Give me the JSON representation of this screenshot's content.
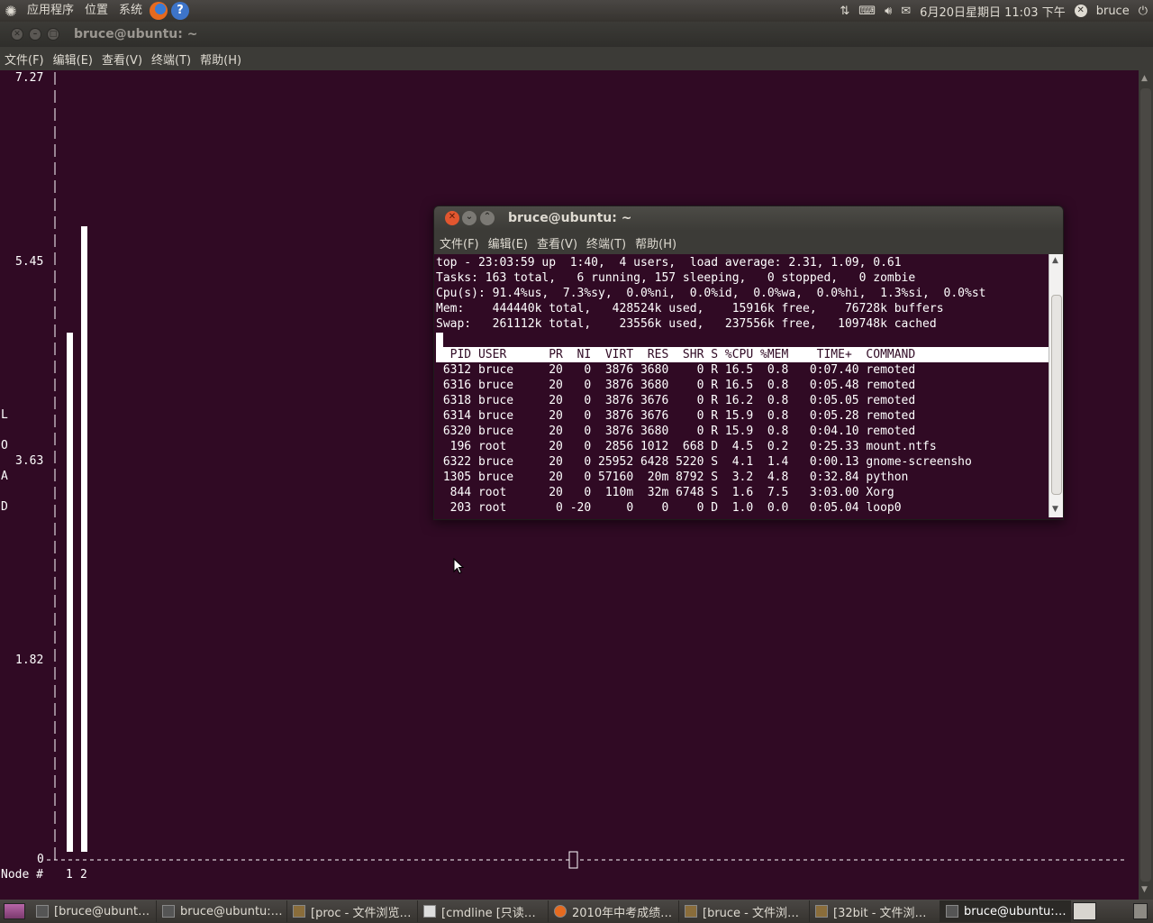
{
  "top_panel": {
    "menus": [
      "应用程序",
      "位置",
      "系统"
    ],
    "datetime": "6月20日星期日 11:03 下午",
    "user": "bruce"
  },
  "main_window": {
    "title": "bruce@ubuntu: ~",
    "menus": [
      "文件(F)",
      "编辑(E)",
      "查看(V)",
      "终端(T)",
      "帮助(H)"
    ],
    "load_chart": {
      "y_ticks": [
        "7.27",
        "5.45",
        "3.63",
        "1.82",
        "0"
      ],
      "side_label": [
        "L",
        "O",
        "A",
        "D"
      ],
      "x_axis_label": "Node #",
      "nodes": [
        "1",
        "2"
      ]
    }
  },
  "chart_data": {
    "type": "bar",
    "categories": [
      "1",
      "2"
    ],
    "values": [
      4.88,
      5.88
    ],
    "ylabel": "LOAD",
    "xlabel": "Node #",
    "ylim": [
      0,
      7.27
    ],
    "y_ticks": [
      7.27,
      5.45,
      3.63,
      1.82,
      0
    ]
  },
  "top_window": {
    "title": "bruce@ubuntu: ~",
    "menus": [
      "文件(F)",
      "编辑(E)",
      "查看(V)",
      "终端(T)",
      "帮助(H)"
    ],
    "summary": [
      "top - 23:03:59 up  1:40,  4 users,  load average: 2.31, 1.09, 0.61",
      "Tasks: 163 total,   6 running, 157 sleeping,   0 stopped,   0 zombie",
      "Cpu(s): 91.4%us,  7.3%sy,  0.0%ni,  0.0%id,  0.0%wa,  0.0%hi,  1.3%si,  0.0%st",
      "Mem:    444440k total,   428524k used,    15916k free,    76728k buffers",
      "Swap:   261112k total,    23556k used,   237556k free,   109748k cached"
    ],
    "header": "  PID USER      PR  NI  VIRT  RES  SHR S %CPU %MEM    TIME+  COMMAND",
    "rows": [
      " 6312 bruce     20   0  3876 3680    0 R 16.5  0.8   0:07.40 remoted",
      " 6316 bruce     20   0  3876 3680    0 R 16.5  0.8   0:05.48 remoted",
      " 6318 bruce     20   0  3876 3676    0 R 16.2  0.8   0:05.05 remoted",
      " 6314 bruce     20   0  3876 3676    0 R 15.9  0.8   0:05.28 remoted",
      " 6320 bruce     20   0  3876 3680    0 R 15.9  0.8   0:04.10 remoted",
      "  196 root      20   0  2856 1012  668 D  4.5  0.2   0:25.33 mount.ntfs",
      " 6322 bruce     20   0 25952 6428 5220 S  4.1  1.4   0:00.13 gnome-screensho",
      " 1305 bruce     20   0 57160  20m 8792 S  3.2  4.8   0:32.84 python",
      "  844 root      20   0  110m  32m 6748 S  1.6  7.5   3:03.00 Xorg",
      "  203 root       0 -20     0    0    0 D  1.0  0.0   0:05.04 loop0"
    ]
  },
  "taskbar": {
    "tasks": [
      {
        "label": "[bruce@ubunt…",
        "active": false
      },
      {
        "label": "bruce@ubuntu:…",
        "active": false
      },
      {
        "label": "[proc - 文件浏览…",
        "active": false
      },
      {
        "label": "[cmdline [只读…",
        "active": false
      },
      {
        "label": "2010年中考成绩…",
        "active": false
      },
      {
        "label": "[bruce - 文件浏…",
        "active": false
      },
      {
        "label": "[32bit - 文件浏…",
        "active": false
      },
      {
        "label": "bruce@ubuntu:…",
        "active": true
      }
    ]
  }
}
